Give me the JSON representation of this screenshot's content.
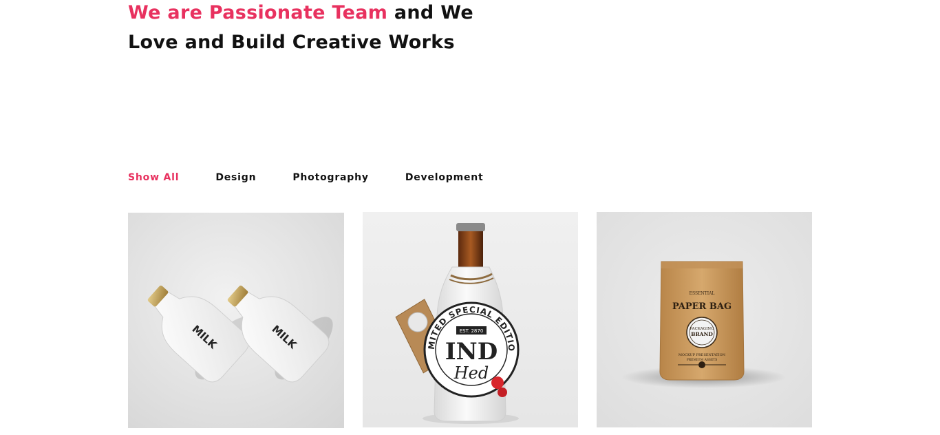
{
  "hero": {
    "heading_accent": "We are Passionate Team",
    "heading_rest_line1": " and We",
    "heading_line2": "Love and Build Creative Works"
  },
  "filters": {
    "items": [
      {
        "label": "Show All",
        "active": true
      },
      {
        "label": "Design",
        "active": false
      },
      {
        "label": "Photography",
        "active": false
      },
      {
        "label": "Development",
        "active": false
      }
    ]
  },
  "portfolio": {
    "items": [
      {
        "icon": "milk-bottles-image",
        "bottle_text": "MILK"
      },
      {
        "icon": "beer-bottle-image",
        "label_arc": "LIMITED SPECIAL EDITION",
        "label_est": "EST. 2870",
        "label_big": "IND",
        "label_script": "Hed"
      },
      {
        "icon": "paper-bag-image",
        "bag_small": "ESSENTIAL",
        "bag_title": "PAPER BAG",
        "bag_circle_1": "PACKAGING",
        "bag_circle_2": "BRAND",
        "bag_footer_1": "MOCKUP PRESENTATION",
        "bag_footer_2": "PREMIUM ASSETS"
      }
    ]
  },
  "colors": {
    "accent": "#e8315f",
    "text": "#111111",
    "background": "#ffffff"
  }
}
